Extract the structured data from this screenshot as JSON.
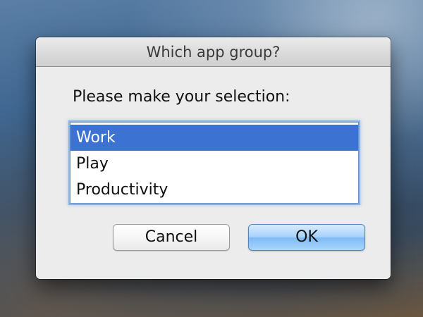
{
  "dialog": {
    "title": "Which app group?",
    "prompt": "Please make your selection:",
    "options": [
      "Work",
      "Play",
      "Productivity"
    ],
    "selected": "Work",
    "buttons": {
      "cancel": "Cancel",
      "ok": "OK"
    }
  },
  "colors": {
    "selection": "#3c73d2",
    "default_button": "#a7d2fb"
  }
}
